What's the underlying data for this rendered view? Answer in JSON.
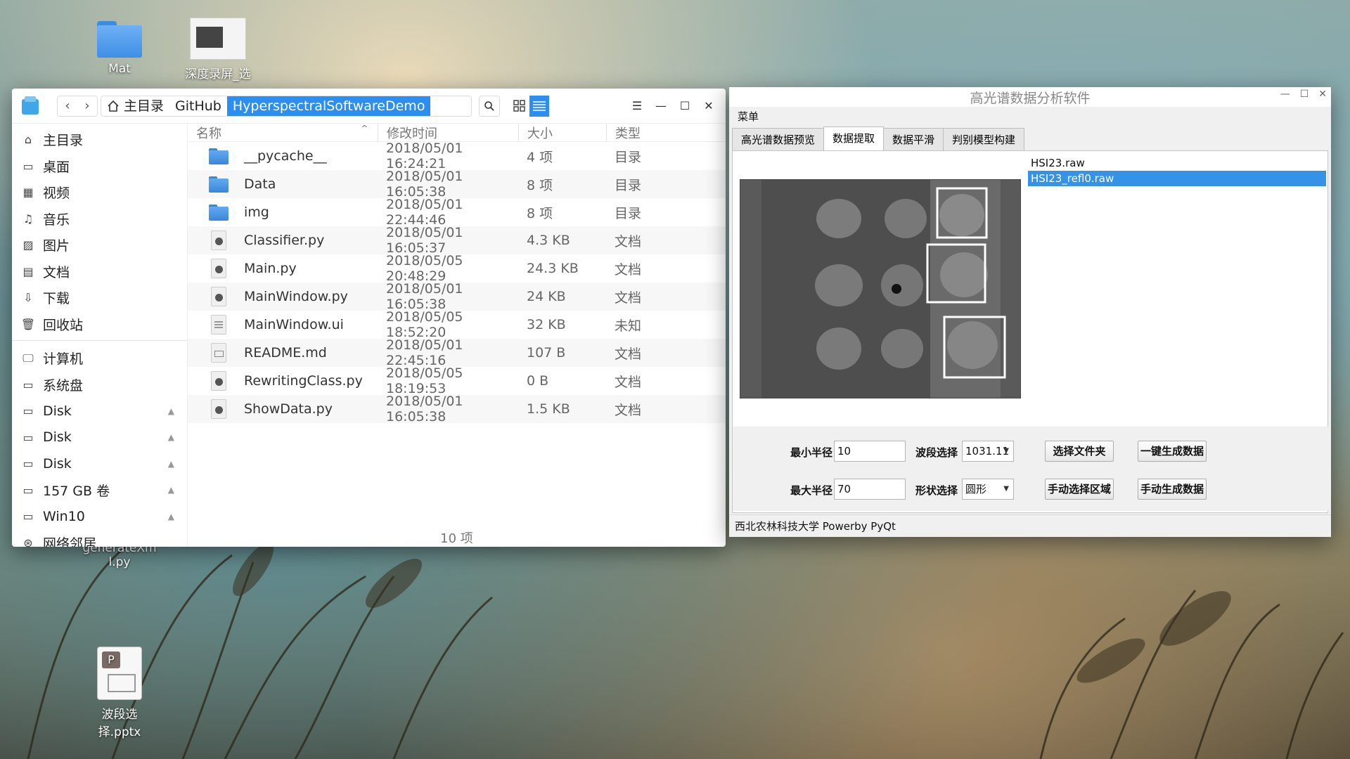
{
  "desktop": {
    "icons": [
      {
        "label": "Mat",
        "icon": "folder-icon"
      },
      {
        "label": "深度录屏_选",
        "icon": "screenshot-thumbnail"
      },
      {
        "label": "generateXml.py",
        "icon": "python-file-icon"
      },
      {
        "label": "波段选择.pptx",
        "icon": "presentation-file-icon"
      }
    ]
  },
  "file_manager": {
    "breadcrumb": [
      "主目录",
      "GitHub",
      "HyperspectralSoftwareDemo"
    ],
    "sidebar": {
      "places": [
        {
          "label": "主目录",
          "icon": "home-icon"
        },
        {
          "label": "桌面",
          "icon": "desktop-icon"
        },
        {
          "label": "视频",
          "icon": "video-icon"
        },
        {
          "label": "音乐",
          "icon": "music-icon"
        },
        {
          "label": "图片",
          "icon": "image-icon"
        },
        {
          "label": "文档",
          "icon": "document-icon"
        },
        {
          "label": "下载",
          "icon": "download-icon"
        },
        {
          "label": "回收站",
          "icon": "trash-icon"
        }
      ],
      "devices": [
        {
          "label": "计算机",
          "icon": "computer-icon"
        },
        {
          "label": "系统盘",
          "icon": "drive-icon"
        },
        {
          "label": "Disk",
          "icon": "drive-icon"
        },
        {
          "label": "Disk",
          "icon": "drive-icon"
        },
        {
          "label": "Disk",
          "icon": "drive-icon"
        },
        {
          "label": "157 GB 卷",
          "icon": "drive-icon"
        },
        {
          "label": "Win10",
          "icon": "drive-icon"
        },
        {
          "label": "网络邻居",
          "icon": "network-icon"
        }
      ]
    },
    "columns": {
      "name": "名称",
      "time": "修改时间",
      "size": "大小",
      "type": "类型"
    },
    "files": [
      {
        "name": "__pycache__",
        "time": "2018/05/01 16:24:21",
        "size": "4 项",
        "type": "目录",
        "kind": "folder"
      },
      {
        "name": "Data",
        "time": "2018/05/01 16:05:38",
        "size": "8 项",
        "type": "目录",
        "kind": "folder"
      },
      {
        "name": "img",
        "time": "2018/05/01 22:44:46",
        "size": "8 项",
        "type": "目录",
        "kind": "folder"
      },
      {
        "name": "Classifier.py",
        "time": "2018/05/01 16:05:37",
        "size": "4.3 KB",
        "type": "文档",
        "kind": "python"
      },
      {
        "name": "Main.py",
        "time": "2018/05/05 20:48:29",
        "size": "24.3 KB",
        "type": "文档",
        "kind": "python"
      },
      {
        "name": "MainWindow.py",
        "time": "2018/05/01 16:05:38",
        "size": "24 KB",
        "type": "文档",
        "kind": "python"
      },
      {
        "name": "MainWindow.ui",
        "time": "2018/05/05 18:52:20",
        "size": "32 KB",
        "type": "未知",
        "kind": "text"
      },
      {
        "name": "README.md",
        "time": "2018/05/01 22:45:16",
        "size": "107 B",
        "type": "文档",
        "kind": "markdown"
      },
      {
        "name": "RewritingClass.py",
        "time": "2018/05/05 18:19:53",
        "size": "0 B",
        "type": "文档",
        "kind": "python"
      },
      {
        "name": "ShowData.py",
        "time": "2018/05/01 16:05:38",
        "size": "1.5 KB",
        "type": "文档",
        "kind": "python"
      }
    ],
    "status": "10 项"
  },
  "hs_app": {
    "title": "高光谱数据分析软件",
    "menu": "菜单",
    "tabs": [
      "高光谱数据预览",
      "数据提取",
      "数据平滑",
      "判别模型构建"
    ],
    "active_tab": "数据提取",
    "file_list": [
      "HSI23.raw",
      "HSI23_refl0.raw"
    ],
    "selected_file": "HSI23_refl0.raw",
    "form": {
      "min_radius_label": "最小半径",
      "min_radius_value": "10",
      "max_radius_label": "最大半径",
      "max_radius_value": "70",
      "band_label": "波段选择",
      "band_value": "1031.11",
      "shape_label": "形状选择",
      "shape_value": "圆形",
      "btn_choose_folder": "选择文件夹",
      "btn_one_click": "一键生成数据",
      "btn_manual_region": "手动选择区域",
      "btn_manual_generate": "手动生成数据"
    },
    "status": "西北农林科技大学  Powerby PyQt"
  },
  "colors": {
    "accent": "#2b8ef0",
    "selection": "#3493e6"
  }
}
